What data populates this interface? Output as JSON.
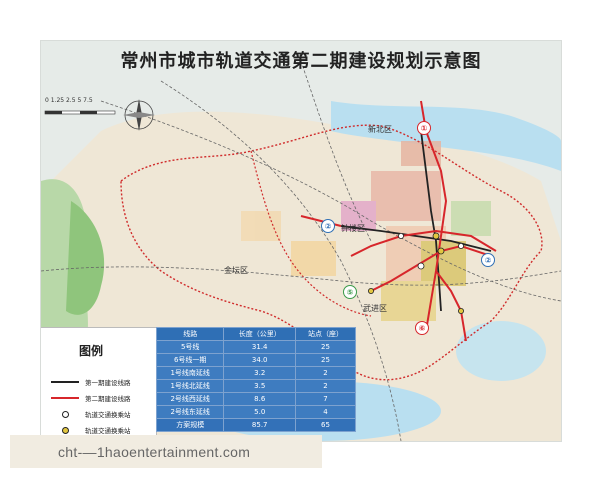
{
  "map": {
    "title": "常州市城市轨道交通第二期建设规划示意图",
    "scale_label": "0 1.25 2.5 5 7.5",
    "places": [
      "新北区",
      "钟楼区",
      "金坛区",
      "武进区"
    ],
    "line_badges": [
      "①",
      "②",
      "⑤",
      "⑥",
      "②"
    ]
  },
  "legend": {
    "title": "图例",
    "items": [
      {
        "label": "第一期建设线路",
        "symbol": "line",
        "color": "#222222"
      },
      {
        "label": "第二期建设线路",
        "symbol": "line",
        "color": "#d7262b"
      },
      {
        "label": "轨道交通换乘站",
        "symbol": "open-circle",
        "color": "#222222"
      },
      {
        "label": "轨道交通换乘站",
        "symbol": "filled-circle",
        "color": "#e2c640"
      }
    ]
  },
  "table": {
    "headers": [
      "线路",
      "长度（公里）",
      "站点（座）"
    ],
    "rows": [
      [
        "5号线",
        "31.4",
        "25"
      ],
      [
        "6号线一期",
        "34.0",
        "25"
      ],
      [
        "1号线南延线",
        "3.2",
        "2"
      ],
      [
        "1号线北延线",
        "3.5",
        "2"
      ],
      [
        "2号线西延线",
        "8.6",
        "7"
      ],
      [
        "2号线东延线",
        "5.0",
        "4"
      ],
      [
        "方案规模",
        "85.7",
        "65"
      ]
    ]
  },
  "watermark": {
    "text": "cht-—1haoentertainment.com"
  },
  "colors": {
    "district_boundary": "#d02b2b",
    "line1": "#222222",
    "line2": "#d7262b",
    "water": "#b9dff0",
    "table_header": "#2f6fb5",
    "table_body": "#3e7cc0"
  }
}
